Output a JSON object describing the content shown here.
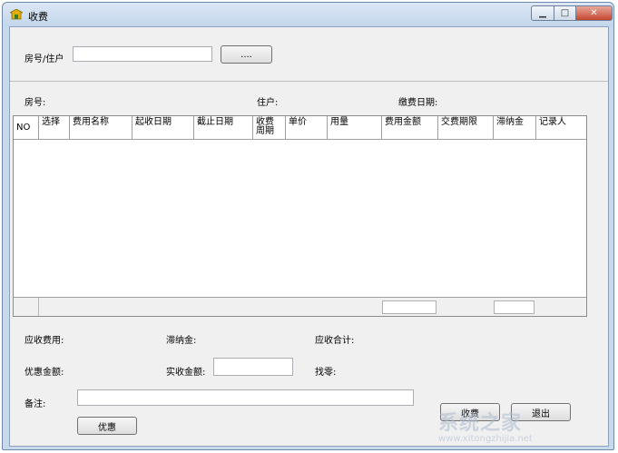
{
  "window": {
    "title": "收费",
    "controls": {
      "minimize": "▭",
      "maximize": "□",
      "close": "✕"
    }
  },
  "search": {
    "label": "房号/住户",
    "value": "",
    "browse_button": "...."
  },
  "info": {
    "room_label": "房号:",
    "resident_label": "住户:",
    "pay_date_label": "缴费日期:"
  },
  "grid": {
    "columns": [
      "NO",
      "选择",
      "费用名称",
      "起收日期",
      "截止日期",
      "收费\n周期",
      "单价",
      "用量",
      "费用金额",
      "交费期限",
      "滞纳金",
      "记录人"
    ],
    "rows": []
  },
  "summary": {
    "receivable_fee_label": "应收费用:",
    "late_fee_label": "滞纳金:",
    "total_receivable_label": "应收合计:",
    "discount_amount_label": "优惠金额:",
    "paid_amount_label": "实收金额:",
    "paid_amount_value": "",
    "change_label": "找零:",
    "remark_label": "备注:",
    "remark_value": ""
  },
  "buttons": {
    "discount": "优惠",
    "charge": "收费",
    "exit": "退出"
  },
  "watermark": {
    "text": "系统之家",
    "url": "www.xitongzhijia.net"
  }
}
